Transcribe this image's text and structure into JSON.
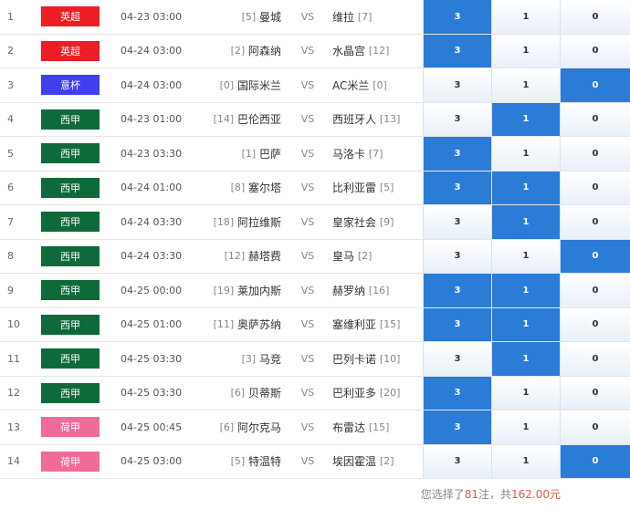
{
  "league_colors": {
    "英超": "#ee1c24",
    "意杯": "#3f3fee",
    "西甲": "#0f6a3b",
    "荷甲": "#f06b9a"
  },
  "selected_color": "#2a7cd6",
  "vs_label": "VS",
  "odds_labels": [
    "3",
    "1",
    "0"
  ],
  "matches": [
    {
      "idx": "1",
      "league": "英超",
      "time": "04-23 03:00",
      "home_rank": "[5]",
      "home": "曼城",
      "away": "维拉",
      "away_rank": "[7]",
      "sel": [
        true,
        false,
        false
      ]
    },
    {
      "idx": "2",
      "league": "英超",
      "time": "04-24 03:00",
      "home_rank": "[2]",
      "home": "阿森纳",
      "away": "水晶宫",
      "away_rank": "[12]",
      "sel": [
        true,
        false,
        false
      ]
    },
    {
      "idx": "3",
      "league": "意杯",
      "time": "04-24 03:00",
      "home_rank": "[0]",
      "home": "国际米兰",
      "away": "AC米兰",
      "away_rank": "[0]",
      "sel": [
        false,
        false,
        true
      ]
    },
    {
      "idx": "4",
      "league": "西甲",
      "time": "04-23 01:00",
      "home_rank": "[14]",
      "home": "巴伦西亚",
      "away": "西班牙人",
      "away_rank": "[13]",
      "sel": [
        false,
        true,
        false
      ]
    },
    {
      "idx": "5",
      "league": "西甲",
      "time": "04-23 03:30",
      "home_rank": "[1]",
      "home": "巴萨",
      "away": "马洛卡",
      "away_rank": "[7]",
      "sel": [
        true,
        false,
        false
      ]
    },
    {
      "idx": "6",
      "league": "西甲",
      "time": "04-24 01:00",
      "home_rank": "[8]",
      "home": "塞尔塔",
      "away": "比利亚雷",
      "away_rank": "[5]",
      "sel": [
        true,
        true,
        false
      ]
    },
    {
      "idx": "7",
      "league": "西甲",
      "time": "04-24 03:30",
      "home_rank": "[18]",
      "home": "阿拉维斯",
      "away": "皇家社会",
      "away_rank": "[9]",
      "sel": [
        false,
        true,
        false
      ]
    },
    {
      "idx": "8",
      "league": "西甲",
      "time": "04-24 03:30",
      "home_rank": "[12]",
      "home": "赫塔费",
      "away": "皇马",
      "away_rank": "[2]",
      "sel": [
        false,
        false,
        true
      ]
    },
    {
      "idx": "9",
      "league": "西甲",
      "time": "04-25 00:00",
      "home_rank": "[19]",
      "home": "莱加内斯",
      "away": "赫罗纳",
      "away_rank": "[16]",
      "sel": [
        true,
        true,
        false
      ]
    },
    {
      "idx": "10",
      "league": "西甲",
      "time": "04-25 01:00",
      "home_rank": "[11]",
      "home": "奥萨苏纳",
      "away": "塞维利亚",
      "away_rank": "[15]",
      "sel": [
        true,
        true,
        false
      ]
    },
    {
      "idx": "11",
      "league": "西甲",
      "time": "04-25 03:30",
      "home_rank": "[3]",
      "home": "马竞",
      "away": "巴列卡诺",
      "away_rank": "[10]",
      "sel": [
        false,
        true,
        false
      ]
    },
    {
      "idx": "12",
      "league": "西甲",
      "time": "04-25 03:30",
      "home_rank": "[6]",
      "home": "贝蒂斯",
      "away": "巴利亚多",
      "away_rank": "[20]",
      "sel": [
        true,
        false,
        false
      ]
    },
    {
      "idx": "13",
      "league": "荷甲",
      "time": "04-25 00:45",
      "home_rank": "[6]",
      "home": "阿尔克马",
      "away": "布雷达",
      "away_rank": "[15]",
      "sel": [
        true,
        false,
        false
      ]
    },
    {
      "idx": "14",
      "league": "荷甲",
      "time": "04-25 03:00",
      "home_rank": "[5]",
      "home": "特温特",
      "away": "埃因霍温",
      "away_rank": "[2]",
      "sel": [
        false,
        false,
        true
      ]
    }
  ],
  "summary": {
    "prefix": "您选择了",
    "count": "81",
    "mid": "注，共",
    "amount": "162.00元"
  }
}
